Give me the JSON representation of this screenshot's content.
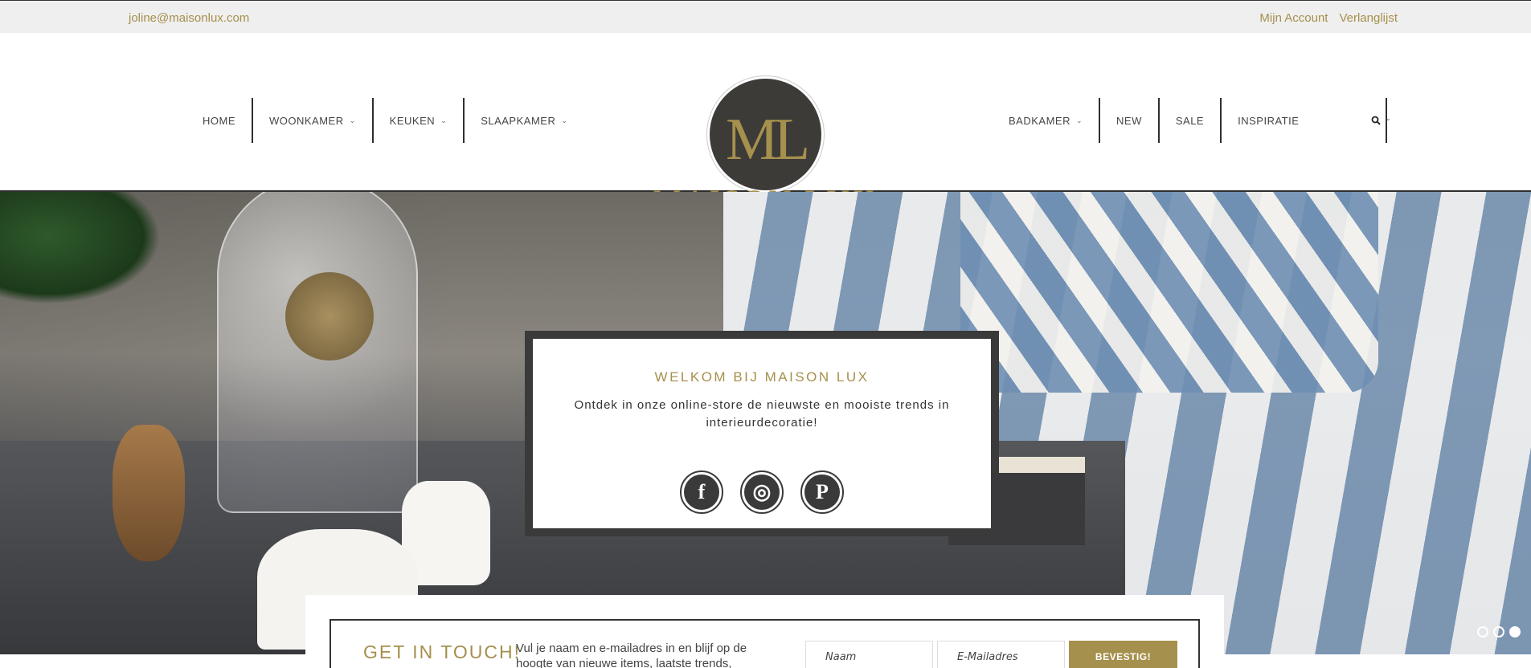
{
  "topbar": {
    "email": "joline@maisonlux.com",
    "account": "Mijn Account",
    "wishlist": "Verlanglijst"
  },
  "brand": {
    "monogram": "ML",
    "name": "MAISON LUX",
    "accent_color": "#a6904d"
  },
  "nav_left": [
    {
      "label": "HOME"
    },
    {
      "label": "WOONKAMER",
      "chevron": "⌄"
    },
    {
      "label": "KEUKEN",
      "chevron": "⌄"
    },
    {
      "label": "SLAAPKAMER",
      "chevron": "⌄"
    }
  ],
  "nav_right": [
    {
      "label": "BADKAMER",
      "chevron": "⌄"
    },
    {
      "label": "NEW"
    },
    {
      "label": "SALE"
    },
    {
      "label": "INSPIRATIE"
    }
  ],
  "search": {
    "icon": "search-icon",
    "glyph": "🔍︎",
    "chevron": "⌄"
  },
  "welcome": {
    "title": "WELKOM BIJ MAISON LUX",
    "text": "Ontdek in onze online-store de nieuwste en mooiste trends in interieurdecoratie!",
    "social": [
      {
        "name": "facebook-icon",
        "glyph": "f"
      },
      {
        "name": "instagram-icon",
        "glyph": "◎"
      },
      {
        "name": "pinterest-icon",
        "glyph": "P"
      }
    ]
  },
  "slider": {
    "slide_count": 3,
    "active_slide": 3
  },
  "newsletter": {
    "title": "GET IN TOUCH!",
    "description": "Vul je naam en e-mailadres in en blijf op de hoogte van nieuwe items, laatste trends,",
    "name_placeholder": "Naam",
    "email_placeholder": "E-Mailadres",
    "submit_label": "BEVESTIG!"
  }
}
